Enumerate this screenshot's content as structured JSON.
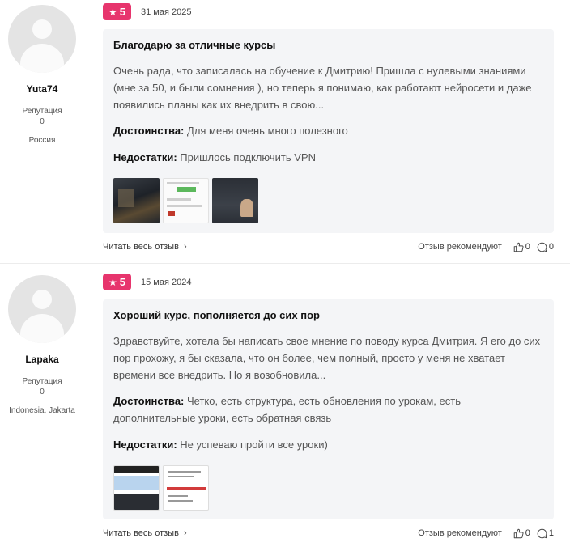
{
  "reviews": [
    {
      "author": {
        "username": "Yuta74",
        "reputation_label": "Репутация",
        "reputation": "0",
        "country": "Россия"
      },
      "rating": "5",
      "date": "31 мая 2025",
      "title": "Благодарю за отличные курсы",
      "body": "Очень рада, что записалась на обучение к Дмитрию! Пришла с нулевыми знаниями (мне за 50, и были сомнения ), но теперь я понимаю, как работают нейросети и даже появились планы как их внедрить в свою...",
      "pros_label": "Достоинства:",
      "pros": "Для меня очень много полезного",
      "cons_label": "Недостатки:",
      "cons": "Пришлось подключить VPN",
      "read_more": "Читать весь отзыв",
      "recommend_label": "Отзыв рекомендуют",
      "likes": "0",
      "comments": "0"
    },
    {
      "author": {
        "username": "Lapaka",
        "reputation_label": "Репутация",
        "reputation": "0",
        "country": "Indonesia, Jakarta"
      },
      "rating": "5",
      "date": "15 мая 2024",
      "title": "Хороший курс, пополняется до сих пор",
      "body": "Здравствуйте, хотела бы написать свое мнение по поводу курса Дмитрия. Я его до сих пор прохожу, я бы сказала, что он более, чем полный, просто у меня не хватает времени все внедрить. Но я возобновила...",
      "pros_label": "Достоинства:",
      "pros": "Четко, есть структура, есть обновления по урокам, есть дополнительные уроки, есть обратная связь",
      "cons_label": "Недостатки:",
      "cons": "Не успеваю пройти все уроки)",
      "read_more": "Читать весь отзыв",
      "recommend_label": "Отзыв рекомендуют",
      "likes": "0",
      "comments": "1"
    }
  ],
  "icons": {
    "rating": "star-icon",
    "read_more": "chevron-right-icon",
    "like": "thumbs-up-icon",
    "comment": "comment-bubble-icon"
  },
  "colors": {
    "badge": "#e7356d",
    "card_bg": "#f4f5f7"
  }
}
